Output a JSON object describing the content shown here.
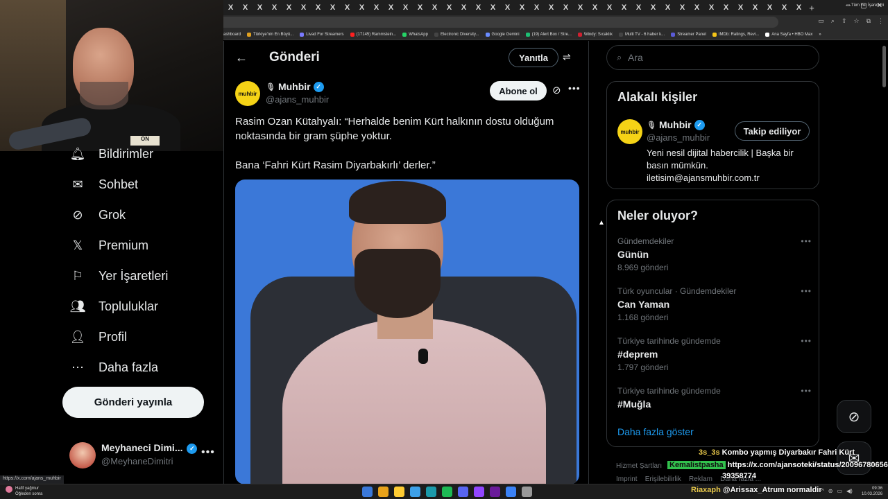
{
  "browser": {
    "tab_close_glyph": "X",
    "new_tab_glyph": "+",
    "bookmarks": [
      {
        "label": "ashboard",
        "color": "#444444"
      },
      {
        "label": "Türkiye'nin En Büyü...",
        "color": "#e0a020"
      },
      {
        "label": "Livad For Streamers",
        "color": "#7a7aff"
      },
      {
        "label": "(17145) Rammstein...",
        "color": "#ff2020"
      },
      {
        "label": "WhatsApp",
        "color": "#25d366"
      },
      {
        "label": "Electronic Diversity...",
        "color": "#444444"
      },
      {
        "label": "Google Gemini",
        "color": "#6a8cff"
      },
      {
        "label": "(19) Alert Box / Stre...",
        "color": "#1dbf73"
      },
      {
        "label": "Windy: Sıcaklık",
        "color": "#d02030"
      },
      {
        "label": "Multi TV - 6 haber k...",
        "color": "#444444"
      },
      {
        "label": "Streamer Panel",
        "color": "#5b5bd6"
      },
      {
        "label": "IMDb: Ratings, Revi...",
        "color": "#f5c518"
      },
      {
        "label": "Ana Sayfa • HBO Max",
        "color": "#ffffff"
      }
    ],
    "bookmarks_overflow": "»",
    "all_bookmarks": "Tüm Yer İşaretleri"
  },
  "stream": {
    "webcam_sign": "ON"
  },
  "nav": {
    "items": [
      {
        "label": "Bildirimler",
        "icon": "bell-icon"
      },
      {
        "label": "Sohbet",
        "icon": "mail-icon"
      },
      {
        "label": "Grok",
        "icon": "grok-icon"
      },
      {
        "label": "Premium",
        "icon": "x-logo-icon"
      },
      {
        "label": "Yer İşaretleri",
        "icon": "bookmark-icon"
      },
      {
        "label": "Topluluklar",
        "icon": "people-icon"
      },
      {
        "label": "Profil",
        "icon": "person-icon"
      },
      {
        "label": "Daha fazla",
        "icon": "more-circle-icon"
      }
    ],
    "post_button": "Gönderi yayınla"
  },
  "account": {
    "name": "Meyhaneci Dimi...",
    "handle": "@MeyhaneDimitri",
    "more": "•••"
  },
  "main": {
    "title": "Gönderi",
    "reply_button": "Yanıtla",
    "post": {
      "avatar_text": "muhbir",
      "name": "Muhbir",
      "handle": "@ajans_muhbir",
      "subscribe": "Abone ol",
      "more": "•••",
      "text": "Rasim Ozan Kütahyalı: “Herhalde benim Kürt halkının dostu olduğum noktasında bir gram şüphe yoktur.\n\nBana ‘Fahri Kürt Rasim Diyarbakırlı’ derler.”"
    }
  },
  "right": {
    "search_placeholder": "Ara",
    "related": {
      "title": "Alakalı kişiler",
      "avatar_text": "muhbir",
      "name": "Muhbir",
      "handle": "@ajans_muhbir",
      "follow_button": "Takip ediliyor",
      "bio": "Yeni nesil dijital habercilik | Başka bir basın mümkün. iletisim@ajansmuhbir.com.tr"
    },
    "trends": {
      "title": "Neler oluyor?",
      "items": [
        {
          "context": "Gündemdekiler",
          "name": "Günün",
          "count": "8.969 gönderi"
        },
        {
          "context": "Türk oyuncular · Gündemdekiler",
          "name": "Can Yaman",
          "count": "1.168 gönderi"
        },
        {
          "context": "Türkiye tarihinde gündemde",
          "name": "#deprem",
          "count": "1.797 gönderi"
        },
        {
          "context": "Türkiye tarihinde gündemde",
          "name": "#Muğla",
          "count": ""
        }
      ],
      "show_more": "Daha fazla göster"
    },
    "footer": {
      "line1": "Hizmet Şartları",
      "line2a": "Imprint",
      "line2b": "Erişilebilirlik",
      "line2c": "Reklam",
      "line2d": "Daha fazla ..."
    }
  },
  "chat": {
    "msg1_user": "3s_3s",
    "msg1_text": "Kombo yapmış Diyarbakır Fahri Kürt",
    "msg2_user": "Kemalistpasha",
    "msg2_text": "https://x.com/ajansoteki/status/20096780656",
    "msg2_text_cont": "39358774",
    "msg3_user": "Riaxaph",
    "msg3_text": "@Arissax_Atrum normaldir"
  },
  "status_url": "https://x.com/ajans_muhbir",
  "taskbar": {
    "weather_line1": "Hafif yağmur",
    "weather_line2": "Öğleden sonra",
    "time": "09:36",
    "date": "10.03.2026",
    "icon_colors": [
      "#3a78d8",
      "#e8a21a",
      "#ffcc33",
      "#3da0e8",
      "#1b9aaa",
      "#1db954",
      "#5865f2",
      "#9146ff",
      "#6a1b9a",
      "#3b82f6",
      "#999999"
    ]
  },
  "colors": {
    "accent": "#1d9bf0",
    "brand_yellow": "#f5d316",
    "background": "#000000"
  }
}
